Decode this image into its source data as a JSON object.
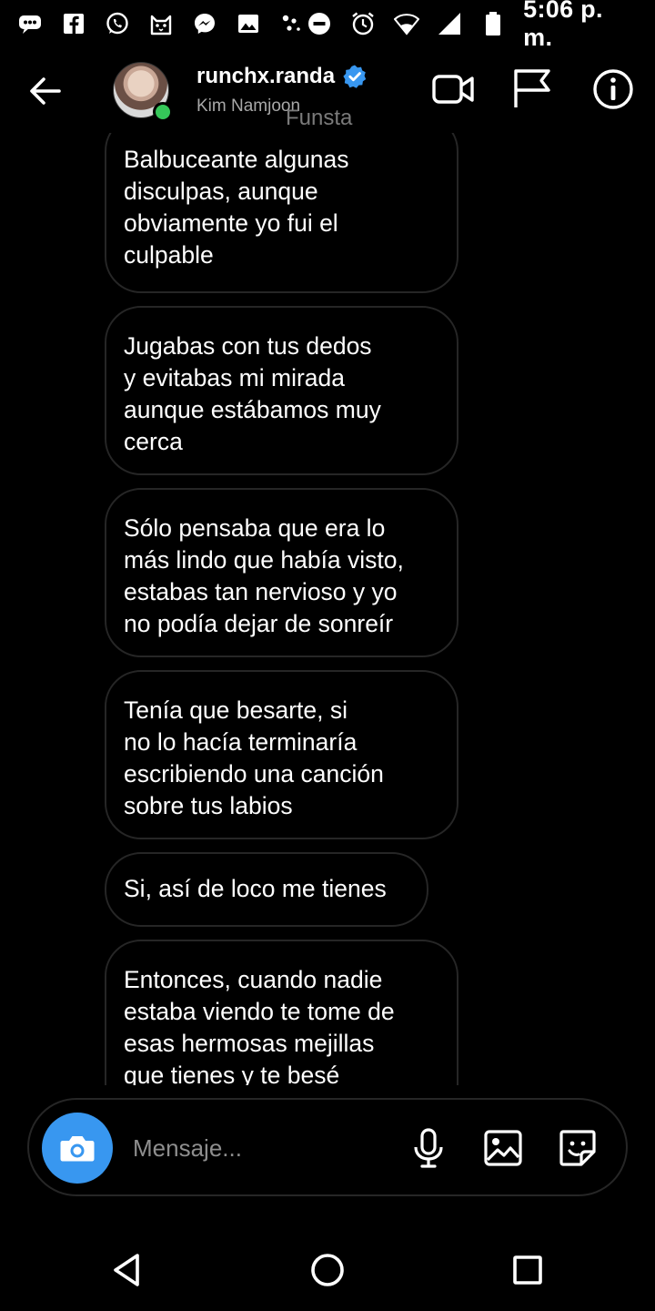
{
  "status_bar": {
    "time": "5:06 p. m.",
    "left_icons": [
      "chat-bubble-icon",
      "facebook-icon",
      "whatsapp-icon",
      "cat-app-icon",
      "messenger-icon",
      "gallery-icon",
      "dots-icon"
    ],
    "right_icons": [
      "do-not-disturb-icon",
      "alarm-icon",
      "wifi-icon",
      "signal-icon",
      "battery-icon"
    ]
  },
  "header": {
    "username": "runchx.randa",
    "verified": true,
    "full_name": "Kim Namjoon",
    "online": true,
    "overlay_text": "Funsta"
  },
  "messages": [
    {
      "text": "Balbuceante algunas\ndisculpas, aunque\nobviamente yo fui el\nculpable"
    },
    {
      "text": "Jugabas con tus dedos\ny evitabas mi mirada\naunque estábamos muy\ncerca"
    },
    {
      "text": "Sólo pensaba que era lo\nmás lindo que había visto,\nestabas tan nervioso y yo\nno podía dejar de sonreír"
    },
    {
      "text": "Tenía que besarte, si\nno lo hacía terminaría\nescribiendo una canción\nsobre tus labios"
    },
    {
      "text": "Si, así de loco me tienes"
    },
    {
      "text": "Entonces, cuando nadie\nestaba viendo te tome de\nesas hermosas mejillas\nque tienes y te besé"
    }
  ],
  "composer": {
    "placeholder": "Mensaje..."
  },
  "colors": {
    "background": "#000000",
    "bubble_border": "#262626",
    "accent_blue": "#3897f0",
    "online_green": "#35c759",
    "secondary_text": "#a8a8a8"
  }
}
